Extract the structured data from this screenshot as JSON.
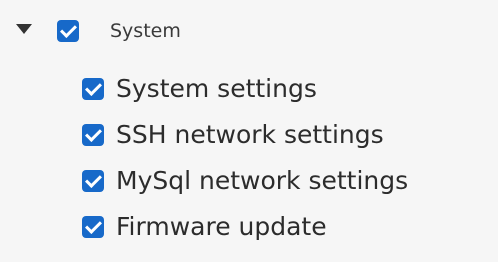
{
  "tree": {
    "root": {
      "label": "System",
      "expanded_icon": "caret-down-icon",
      "checked": true
    },
    "children": [
      {
        "label": "System settings",
        "checked": true
      },
      {
        "label": "SSH network settings",
        "checked": true
      },
      {
        "label": "MySql network settings",
        "checked": true
      },
      {
        "label": "Firmware update",
        "checked": true
      }
    ]
  },
  "colors": {
    "background": "#f6f6f6",
    "checkbox_fill": "#1769c9",
    "text": "#2c2c2c"
  }
}
